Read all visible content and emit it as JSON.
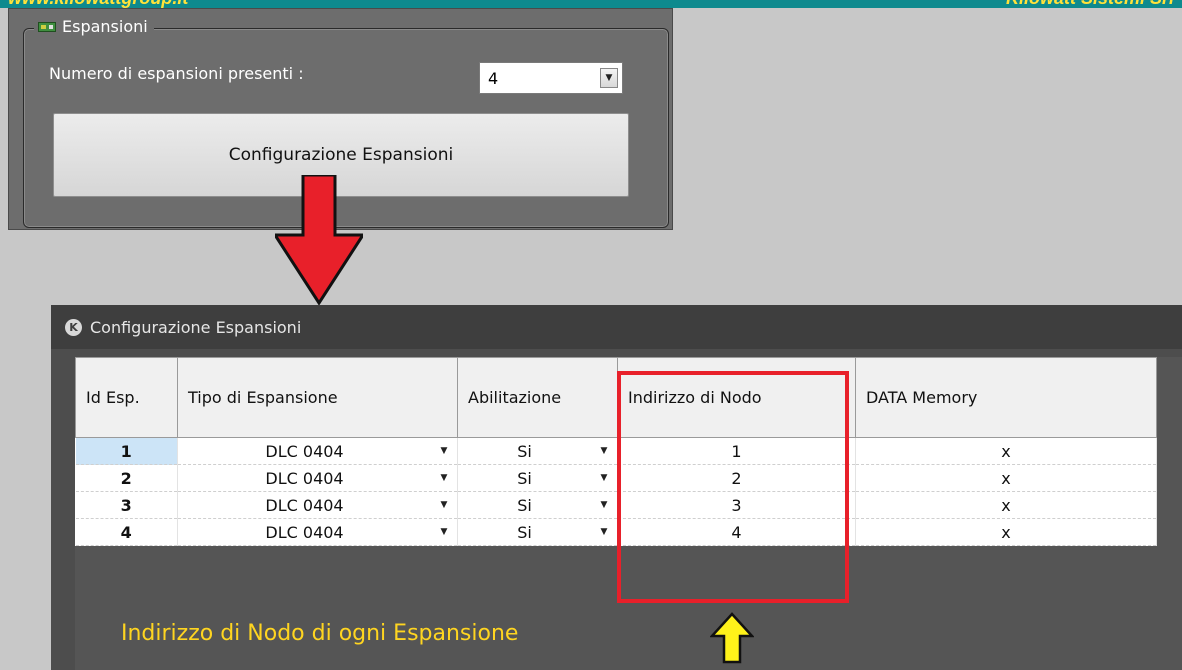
{
  "banner": {
    "left_text": "www.kilowattgroup.it",
    "right_text": "Kilowatt Sistemi Srl"
  },
  "expansions_panel": {
    "legend": "Espansioni",
    "count_label": "Numero di espansioni presenti :",
    "count_value": "4",
    "config_button": "Configurazione Espansioni"
  },
  "config_window": {
    "title": "Configurazione Espansioni",
    "columns": [
      "Id Esp.",
      "Tipo di Espansione",
      "Abilitazione",
      "Indirizzo di Nodo",
      "DATA Memory"
    ],
    "rows": [
      {
        "id": "1",
        "type": "DLC 0404",
        "enabled": "Si",
        "node": "1",
        "memory": "x"
      },
      {
        "id": "2",
        "type": "DLC 0404",
        "enabled": "Si",
        "node": "2",
        "memory": "x"
      },
      {
        "id": "3",
        "type": "DLC 0404",
        "enabled": "Si",
        "node": "3",
        "memory": "x"
      },
      {
        "id": "4",
        "type": "DLC 0404",
        "enabled": "Si",
        "node": "4",
        "memory": "x"
      }
    ]
  },
  "annotation": {
    "caption": "Indirizzo di Nodo di ogni Espansione",
    "arrow_color": "#e8202a",
    "caption_color": "#ffd520",
    "highlight_color": "#e8202a"
  }
}
